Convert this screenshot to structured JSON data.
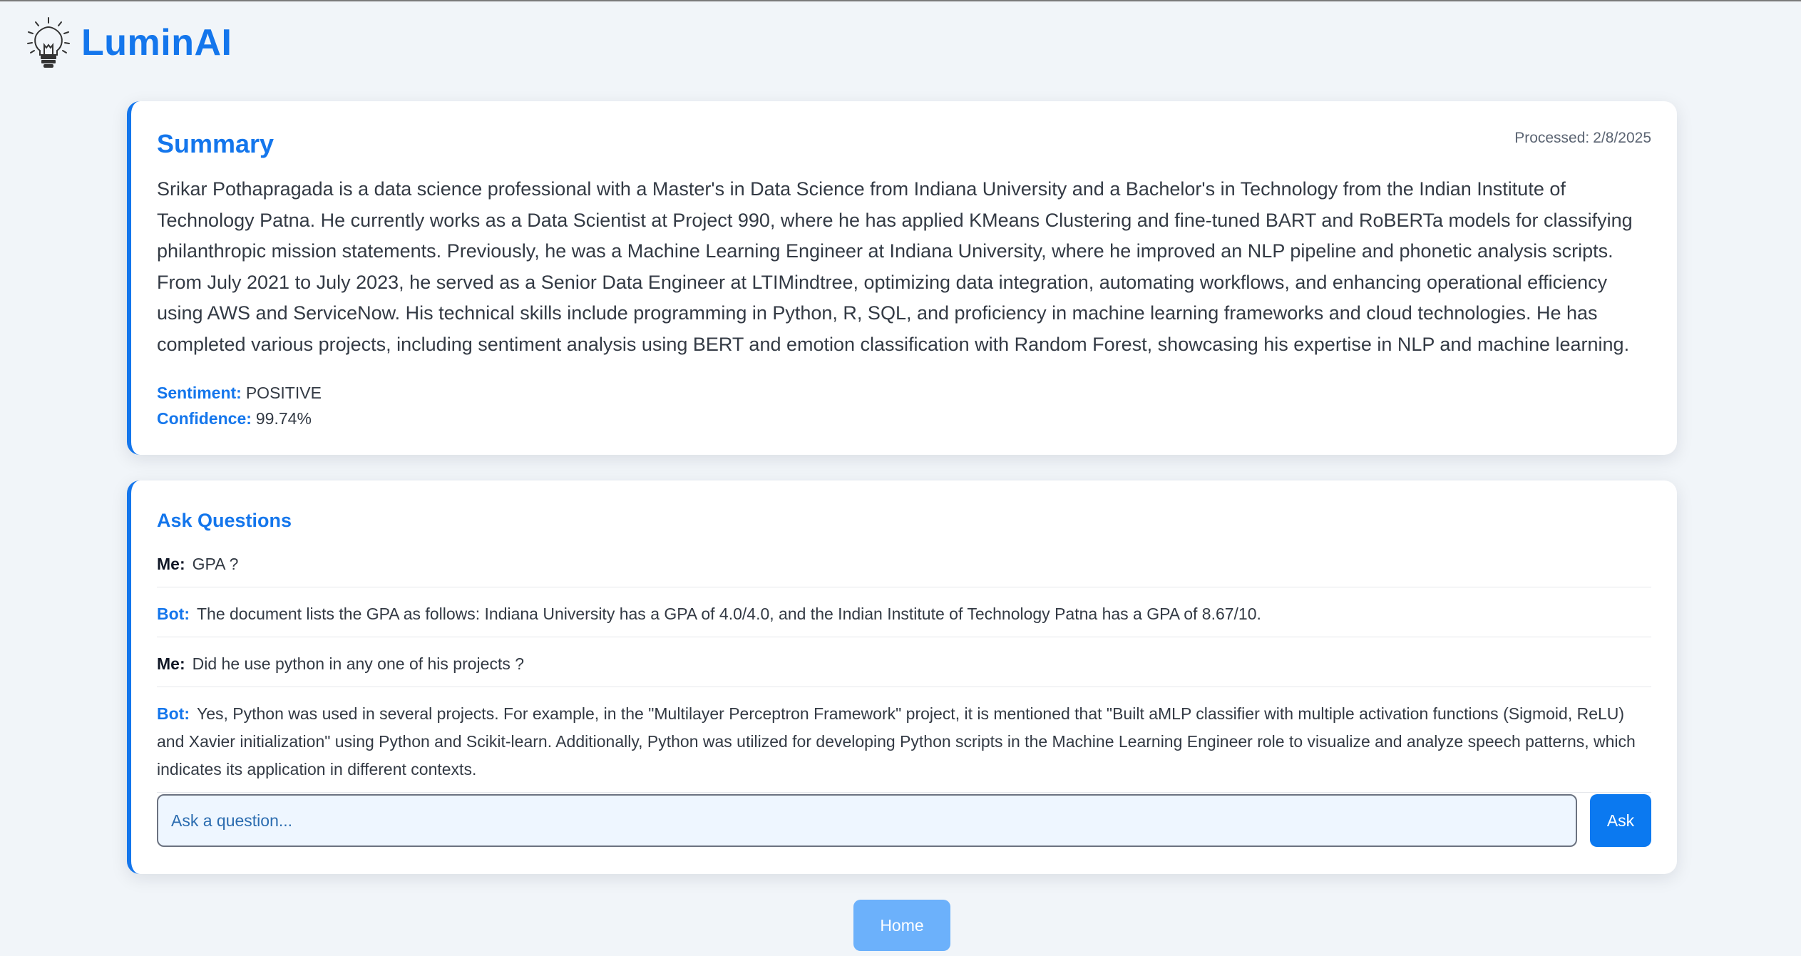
{
  "app": {
    "brand_name": "LuminAI",
    "logo_icon": "lightbulb-icon"
  },
  "summary": {
    "title": "Summary",
    "processed_label": "Processed:",
    "processed_date": "2/8/2025",
    "text": "Srikar Pothapragada is a data science professional with a Master's in Data Science from Indiana University and a Bachelor's in Technology from the Indian Institute of Technology Patna. He currently works as a Data Scientist at Project 990, where he has applied KMeans Clustering and fine-tuned BART and RoBERTa models for classifying philanthropic mission statements. Previously, he was a Machine Learning Engineer at Indiana University, where he improved an NLP pipeline and phonetic analysis scripts. From July 2021 to July 2023, he served as a Senior Data Engineer at LTIMindtree, optimizing data integration, automating workflows, and enhancing operational efficiency using AWS and ServiceNow. His technical skills include programming in Python, R, SQL, and proficiency in machine learning frameworks and cloud technologies. He has completed various projects, including sentiment analysis using BERT and emotion classification with Random Forest, showcasing his expertise in NLP and machine learning.",
    "sentiment_label": "Sentiment:",
    "sentiment_value": "POSITIVE",
    "confidence_label": "Confidence:",
    "confidence_value": "99.74%"
  },
  "qa": {
    "title": "Ask Questions",
    "messages": [
      {
        "who": "Me:",
        "text": "GPA ?"
      },
      {
        "who": "Bot:",
        "text": "The document lists the GPA as follows: Indiana University has a GPA of 4.0/4.0, and the Indian Institute of Technology Patna has a GPA of 8.67/10."
      },
      {
        "who": "Me:",
        "text": "Did he use python in any one of his projects ?"
      },
      {
        "who": "Bot:",
        "text": "Yes, Python was used in several projects. For example, in the \"Multilayer Perceptron Framework\" project, it is mentioned that \"Built aMLP classifier with multiple activation functions (Sigmoid, ReLU) and Xavier initialization\" using Python and Scikit-learn. Additionally, Python was utilized for developing Python scripts in the Machine Learning Engineer role to visualize and analyze speech patterns, which indicates its application in different contexts."
      }
    ],
    "input_value": "",
    "input_placeholder": "Ask a question...",
    "ask_label": "Ask"
  },
  "footer": {
    "home_label": "Home"
  },
  "colors": {
    "accent": "#1476ec",
    "background": "#f1f5f9",
    "home_button": "#6cb1fb"
  }
}
